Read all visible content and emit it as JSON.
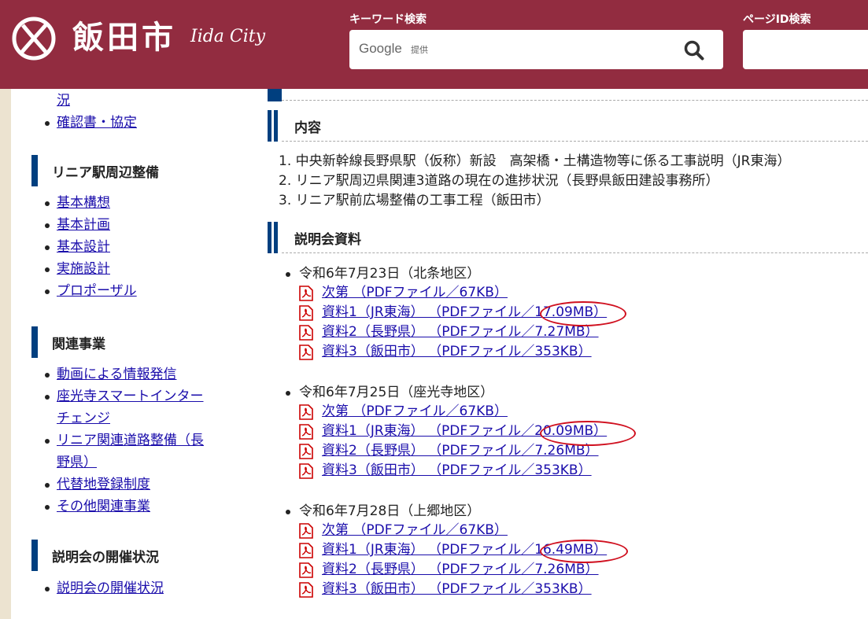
{
  "header": {
    "logo_text": "飯田市",
    "logo_sub": "Iida City",
    "keyword_label": "キーワード検索",
    "google_text": "Google",
    "google_sub": "提供",
    "pageid_label": "ページID検索"
  },
  "sidebar": {
    "group0": [
      "況",
      "確認書・協定"
    ],
    "sections": [
      {
        "title": "リニア駅周辺整備",
        "items": [
          "基本構想",
          "基本計画",
          "基本設計",
          "実施設計",
          "プロポーザル"
        ]
      },
      {
        "title": "関連事業",
        "items": [
          "動画による情報発信",
          "座光寺スマートインター",
          "チェンジ",
          "リニア関連道路整備（長",
          "野県）",
          "代替地登録制度",
          "その他関連事業"
        ]
      },
      {
        "title": "説明会の開催状況",
        "items": [
          "説明会の開催状況"
        ]
      }
    ]
  },
  "main": {
    "naiyo_title": "内容",
    "naiyo_items": [
      "1. 中央新幹線長野県駅（仮称）新設　高架橋・土構造物等に係る工事説明（JR東海）",
      "2. リニア駅周辺県関連3道路の現在の進捗状況（長野県飯田建設事務所）",
      "3. リニア駅前広場整備の工事工程（飯田市）"
    ],
    "shiryo_title": "説明会資料",
    "meetings": [
      {
        "title": "令和6年7月23日（北条地区）",
        "docs": [
          "次第 （PDFファイル／67KB）",
          "資料1（JR東海） （PDFファイル／17.09MB）",
          "資料2（長野県） （PDFファイル／7.27MB）",
          "資料3（飯田市） （PDFファイル／353KB）"
        ]
      },
      {
        "title": "令和6年7月25日（座光寺地区）",
        "docs": [
          "次第 （PDFファイル／67KB）",
          "資料1（JR東海） （PDFファイル／20.09MB）",
          "資料2（長野県） （PDFファイル／7.26MB）",
          "資料3（飯田市） （PDFファイル／353KB）"
        ]
      },
      {
        "title": "令和6年7月28日（上郷地区）",
        "docs": [
          "次第 （PDFファイル／67KB）",
          "資料1（JR東海） （PDFファイル／16.49MB）",
          "資料2（長野県） （PDFファイル／7.26MB）",
          "資料3（飯田市） （PDFファイル／353KB）"
        ]
      }
    ]
  },
  "colors": {
    "header": "#922c40",
    "accent": "#003f7f",
    "link": "#1a0dab",
    "highlight": "#d0101f"
  },
  "icons": {
    "logo": "iida-logo-icon",
    "search": "search-icon",
    "pdf": "pdf-icon"
  }
}
